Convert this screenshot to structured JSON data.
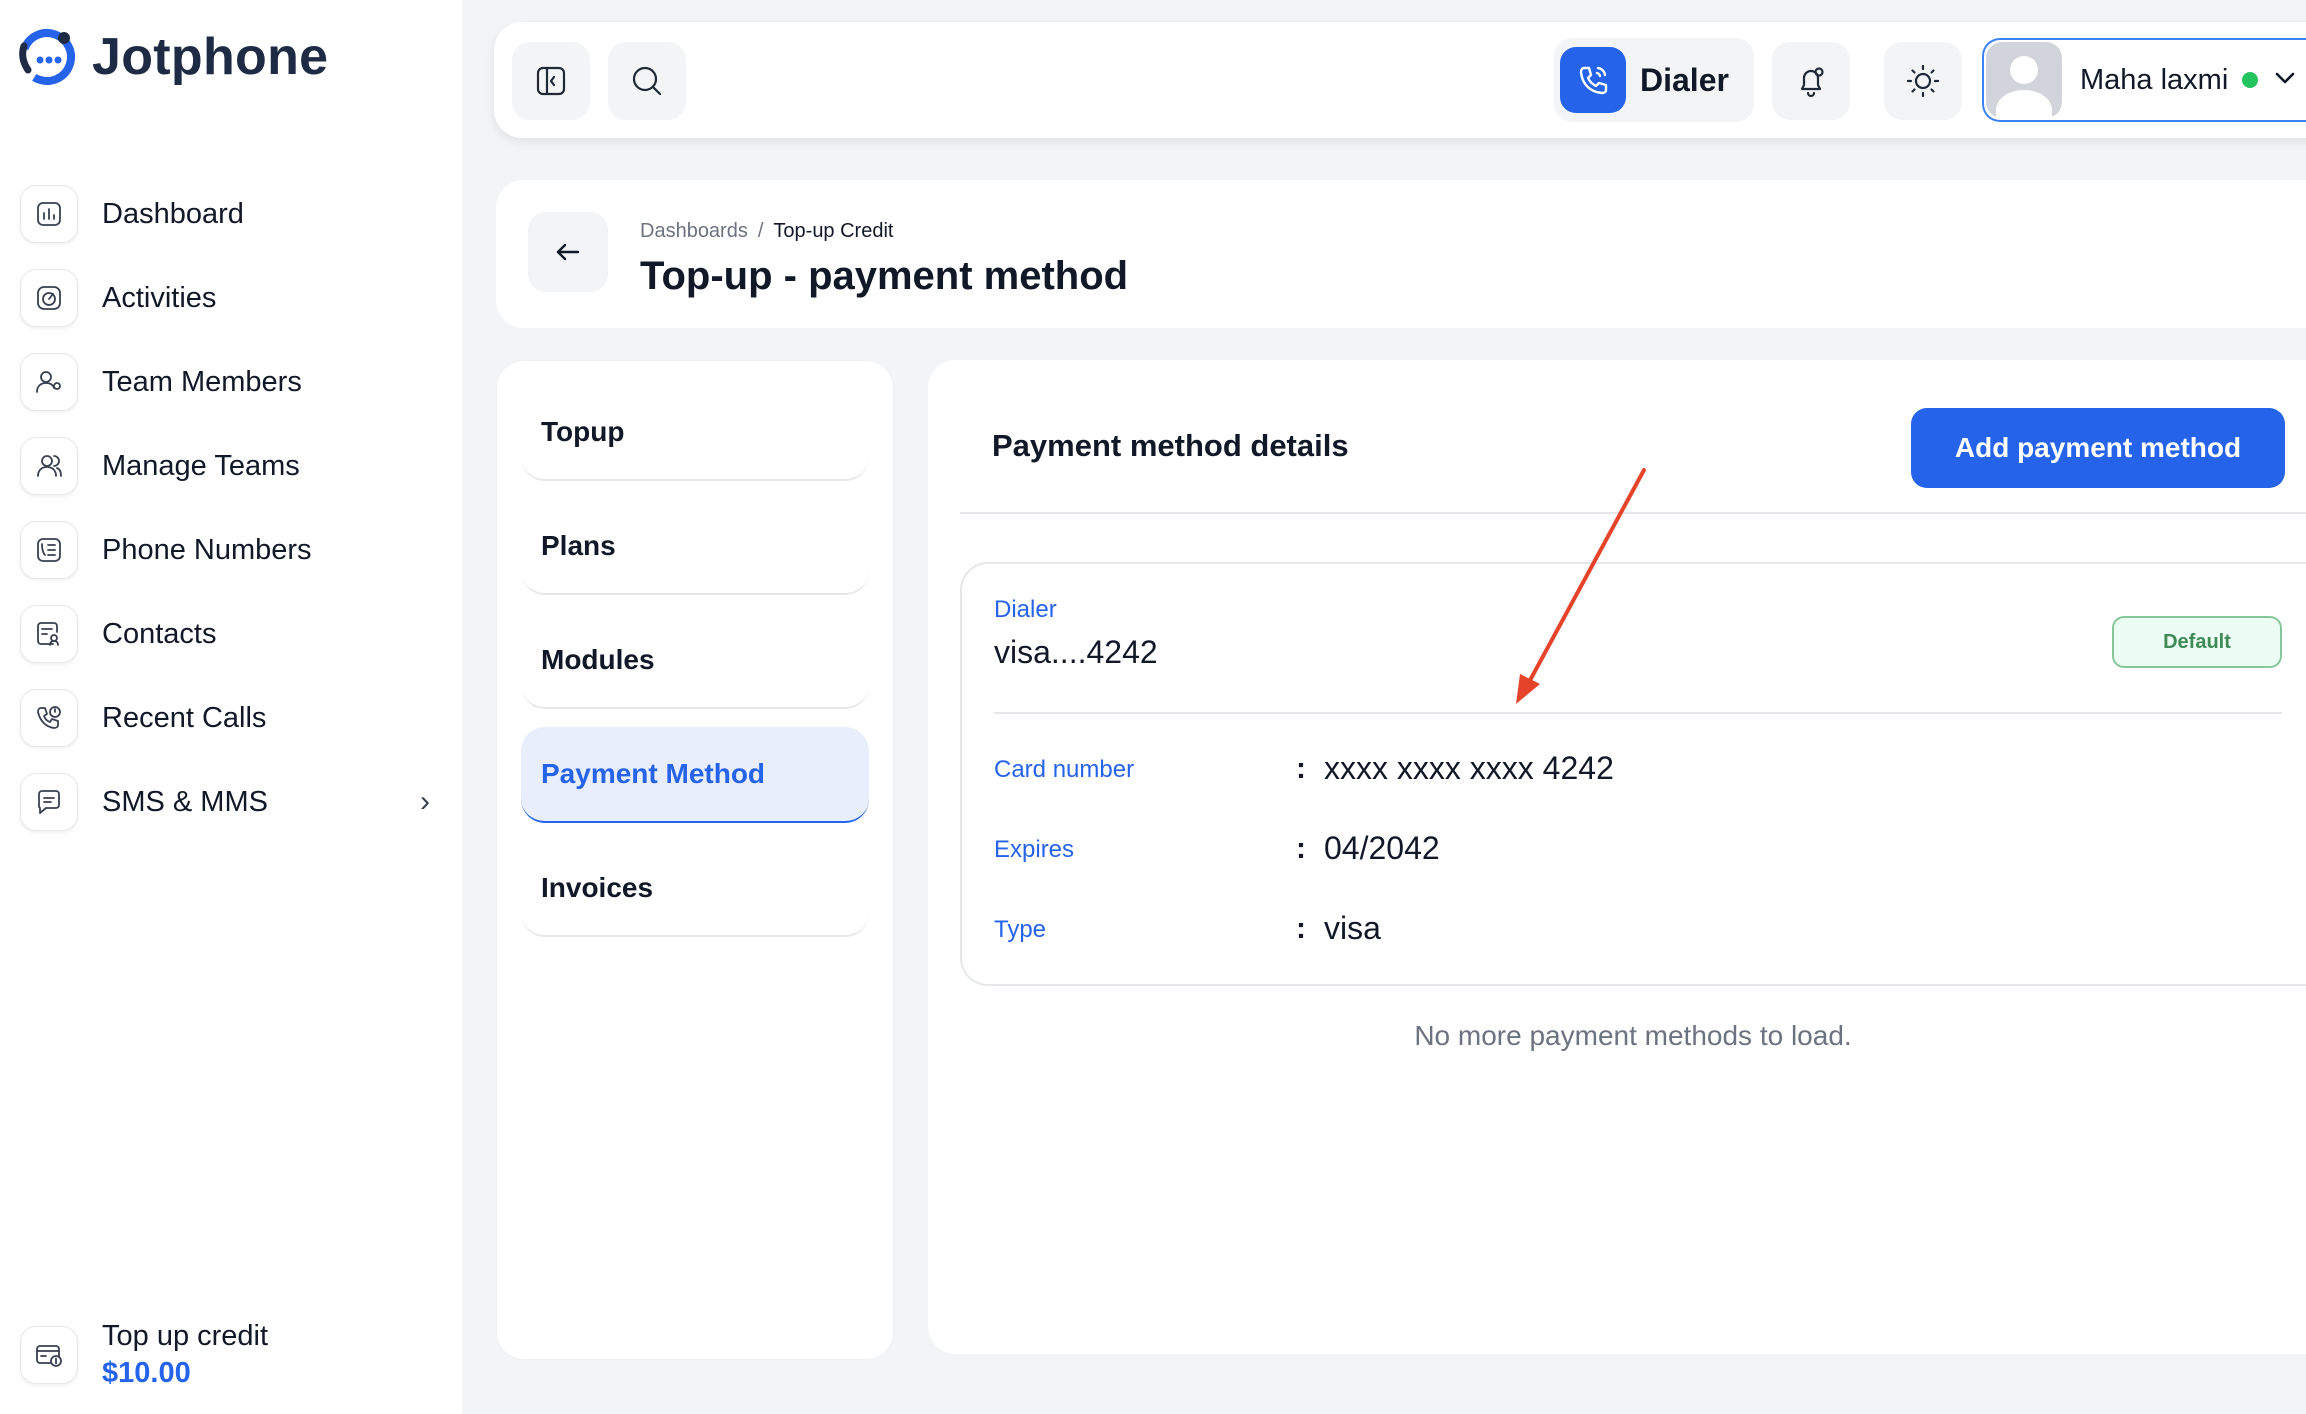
{
  "app": {
    "name": "Jotphone"
  },
  "sidebar": {
    "items": [
      {
        "label": "Dashboard",
        "icon": "chart-icon"
      },
      {
        "label": "Activities",
        "icon": "activity-icon"
      },
      {
        "label": "Team Members",
        "icon": "team-member-icon"
      },
      {
        "label": "Manage Teams",
        "icon": "teams-icon"
      },
      {
        "label": "Phone Numbers",
        "icon": "phone-list-icon"
      },
      {
        "label": "Contacts",
        "icon": "contacts-icon"
      },
      {
        "label": "Recent Calls",
        "icon": "recent-calls-icon"
      },
      {
        "label": "SMS & MMS",
        "icon": "message-icon",
        "has_submenu": true
      }
    ],
    "credit": {
      "label": "Top up credit",
      "amount": "$10.00"
    }
  },
  "topbar": {
    "dialer_label": "Dialer",
    "user_name": "Maha laxmi",
    "user_status": "online"
  },
  "header": {
    "breadcrumb_root": "Dashboards",
    "breadcrumb_sep": "/",
    "breadcrumb_current": "Top-up Credit",
    "title": "Top-up - payment method"
  },
  "tabs": [
    {
      "label": "Topup",
      "active": false
    },
    {
      "label": "Plans",
      "active": false
    },
    {
      "label": "Modules",
      "active": false
    },
    {
      "label": "Payment Method",
      "active": true
    },
    {
      "label": "Invoices",
      "active": false
    }
  ],
  "main": {
    "title": "Payment method details",
    "add_button": "Add payment method",
    "card": {
      "label": "Dialer",
      "name": "visa....4242",
      "badge": "Default",
      "rows": [
        {
          "label": "Card number",
          "colon": ":",
          "value": "xxxx xxxx xxxx 4242"
        },
        {
          "label": "Expires",
          "colon": ":",
          "value": "04/2042"
        },
        {
          "label": "Type",
          "colon": ":",
          "value": "visa"
        }
      ]
    },
    "footer_note": "No more payment methods to load."
  },
  "colors": {
    "accent": "#2563eb",
    "annotation_arrow": "#e5432a",
    "status_online": "#22c55e"
  }
}
